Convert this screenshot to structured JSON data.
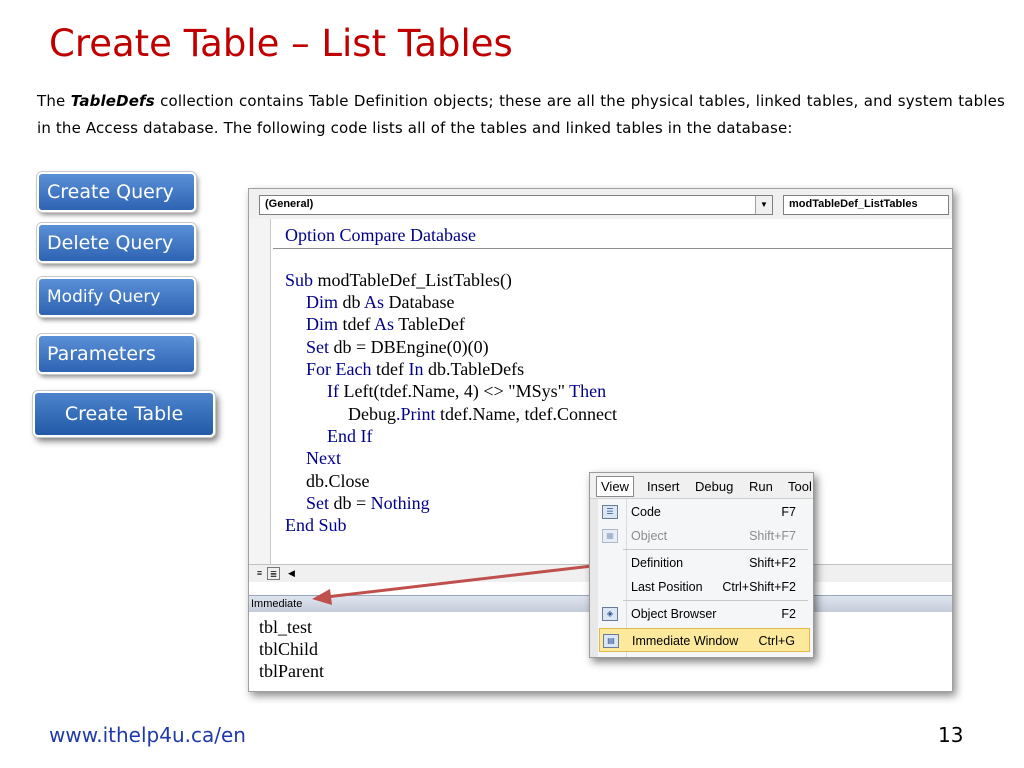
{
  "slide": {
    "title": "Create Table – List Tables",
    "intro_pre": "The ",
    "intro_bold": "TableDefs",
    "intro_post": " collection contains Table Definition objects; these are all the physical tables, linked tables, and system tables in the Access database.  The following code lists all of the tables and linked tables in the database:",
    "footer_url": "www.ithelp4u.ca/en",
    "page_number": "13"
  },
  "nav": {
    "items": [
      {
        "label": "Create Query"
      },
      {
        "label": "Delete Query"
      },
      {
        "label": "Modify Query"
      },
      {
        "label": "Parameters"
      },
      {
        "label": "Create Table"
      }
    ],
    "active": "Create Table"
  },
  "editor": {
    "object_combo": "(General)",
    "procedure_combo": "modTableDef_ListTables",
    "code": {
      "l0_kw": "Option Compare Database",
      "l1_kw": "Sub",
      "l1_rest": " modTableDef_ListTables()",
      "l2_kw": "Dim",
      "l2_mid": " db ",
      "l2_kw2": "As",
      "l2_rest": " Database",
      "l3_kw": "Dim",
      "l3_mid": " tdef ",
      "l3_kw2": "As",
      "l3_rest": " TableDef",
      "l4_kw": "Set",
      "l4_rest": " db = DBEngine(0)(0)",
      "l5_kw": "For Each",
      "l5_mid": " tdef ",
      "l5_kw2": "In",
      "l5_rest": " db.TableDefs",
      "l6_kw": "If",
      "l6_rest": " Left(tdef.Name, 4) <> \"MSys\" ",
      "l6_kw2": "Then",
      "l7_pre": "Debug",
      "l7_kw": ".Print",
      "l7_rest": " tdef.Name, tdef.Connect",
      "l8_kw": "End If",
      "l9_kw": "Next",
      "l10": "db.Close",
      "l11_kw": "Set",
      "l11_mid": " db = ",
      "l11_kw2": "Nothing",
      "l12_kw": "End Sub"
    },
    "immediate_title": "Immediate",
    "immediate_lines": [
      "tbl_test",
      "tblChild",
      "tblParent"
    ],
    "code_color": "#00008b"
  },
  "menu": {
    "bar": [
      "View",
      "Insert",
      "Debug",
      "Run",
      "Tool"
    ],
    "items": [
      {
        "label": "Code",
        "key": "F7",
        "icon": "code-view-icon"
      },
      {
        "label": "Object",
        "key": "Shift+F7",
        "icon": "object-view-icon",
        "disabled": true
      },
      {
        "label": "Definition",
        "key": "Shift+F2"
      },
      {
        "label": "Last Position",
        "key": "Ctrl+Shift+F2"
      },
      {
        "label": "Object Browser",
        "key": "F2",
        "icon": "object-browser-icon"
      },
      {
        "label": "Immediate Window",
        "key": "Ctrl+G",
        "icon": "immediate-window-icon",
        "highlighted": true
      }
    ]
  },
  "colors": {
    "title": "#c00000",
    "nav_button": "#3a6fc0",
    "arrow": "#c0504d",
    "link": "#1f3aa8"
  }
}
